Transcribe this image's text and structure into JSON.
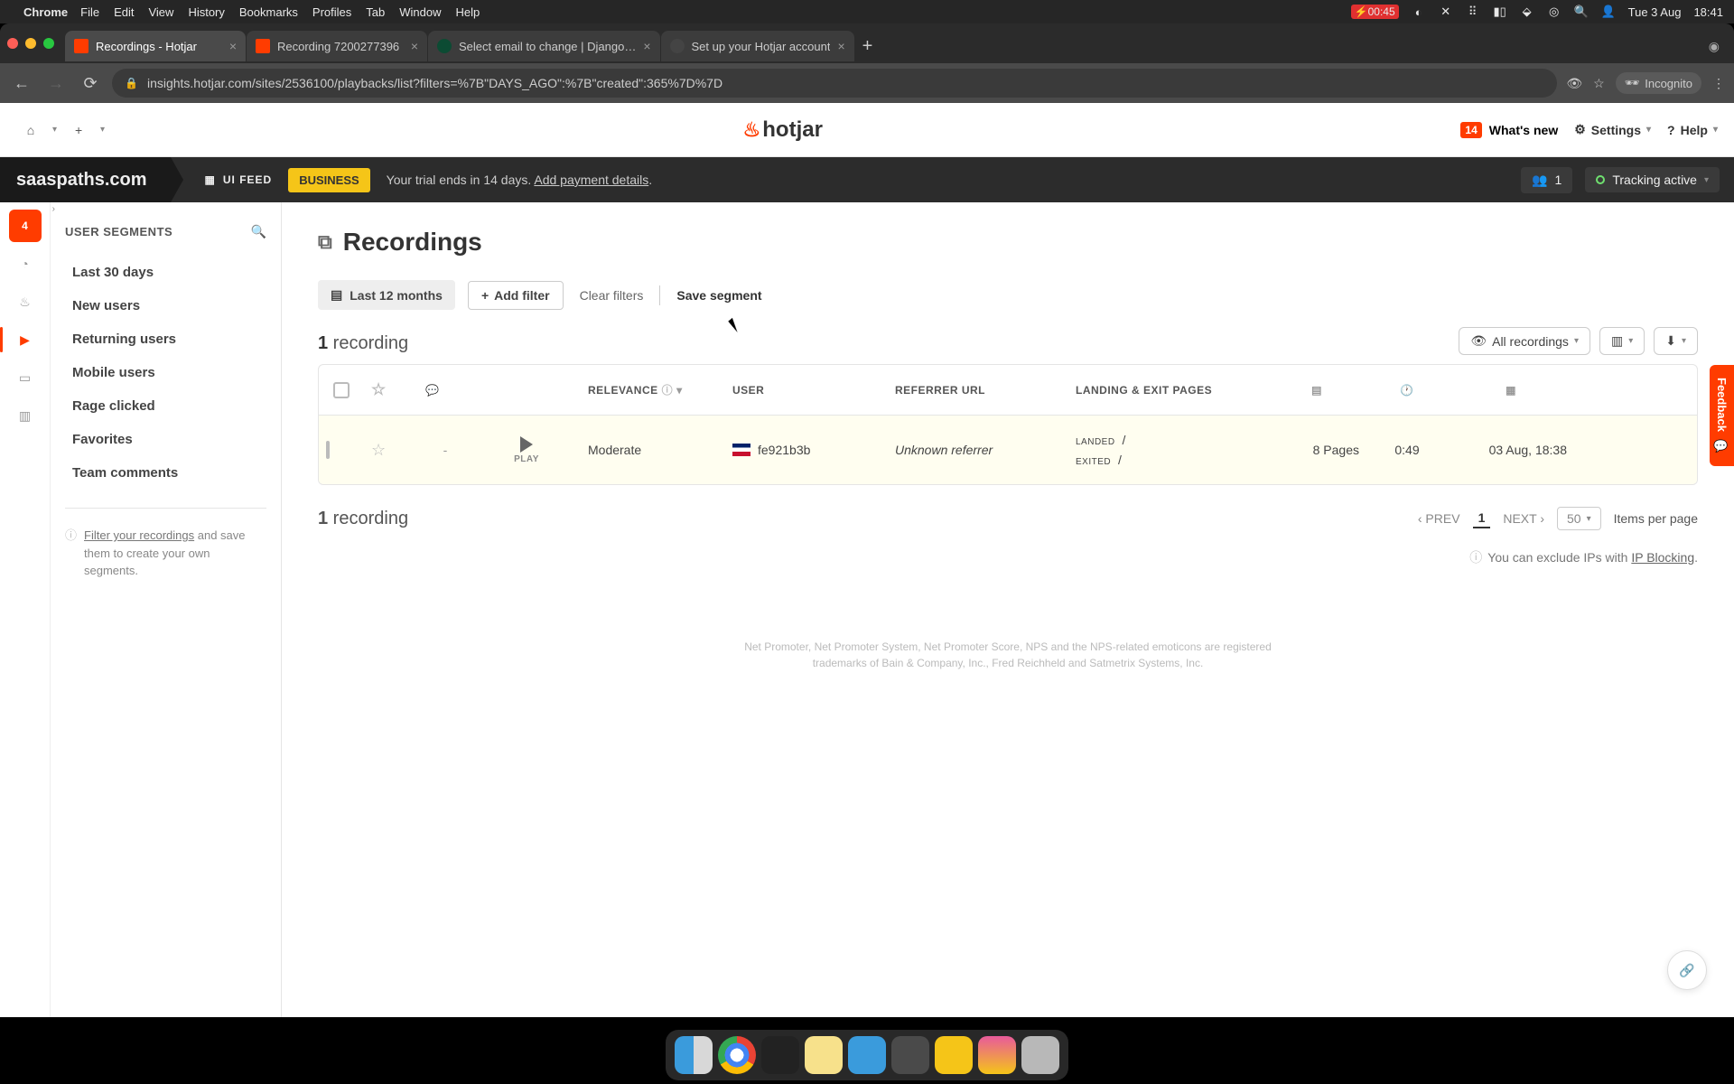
{
  "mac_menu": {
    "app": "Chrome",
    "items": [
      "File",
      "Edit",
      "View",
      "History",
      "Bookmarks",
      "Profiles",
      "Tab",
      "Window",
      "Help"
    ],
    "battery_warn": "00:45",
    "date": "Tue 3 Aug",
    "time": "18:41"
  },
  "chrome": {
    "tabs": [
      {
        "title": "Recordings - Hotjar",
        "active": true,
        "favicon": "hotjar"
      },
      {
        "title": "Recording 7200277396",
        "active": false,
        "favicon": "hotjar"
      },
      {
        "title": "Select email to change | Django…",
        "active": false,
        "favicon": "django"
      },
      {
        "title": "Set up your Hotjar account",
        "active": false,
        "favicon": "hj2"
      }
    ],
    "url": "insights.hotjar.com/sites/2536100/playbacks/list?filters=%7B\"DAYS_AGO\":%7B\"created\":365%7D%7D",
    "incognito": "Incognito"
  },
  "hotjar": {
    "logo": "hotjar",
    "whats_new_badge": "14",
    "whats_new": "What's new",
    "settings": "Settings",
    "help": "Help",
    "site": "saaspaths.com",
    "uifeed": "UI FEED",
    "plan_badge": "BUSINESS",
    "trial_text": "Your trial ends in 14 days. ",
    "trial_link": "Add payment details",
    "trial_period": ".",
    "user_count": "1",
    "tracking": "Tracking active",
    "rail_badge": "4",
    "segments_title": "USER SEGMENTS",
    "segments": [
      "Last 30 days",
      "New users",
      "Returning users",
      "Mobile users",
      "Rage clicked",
      "Favorites",
      "Team comments"
    ],
    "seg_hint_link": "Filter your recordings",
    "seg_hint_rest": " and save them to create your own segments.",
    "page_title": "Recordings",
    "filter_chip": "Last 12 months",
    "add_filter": "Add filter",
    "clear_filters": "Clear filters",
    "save_segment": "Save segment",
    "count_num": "1",
    "count_label": " recording",
    "all_recordings": "All recordings",
    "columns": {
      "relevance": "RELEVANCE",
      "user": "USER",
      "referrer": "REFERRER URL",
      "landing": "LANDING & EXIT PAGES"
    },
    "row": {
      "play": "PLAY",
      "comment": "-",
      "relevance": "Moderate",
      "user_id": "fe921b3b",
      "referrer": "Unknown referrer",
      "landed_label": "LANDED",
      "landed_path": "/",
      "exited_label": "EXITED",
      "exited_path": "/",
      "pages": "8 Pages",
      "duration": "0:49",
      "date": "03 Aug, 18:38"
    },
    "prev": "‹ PREV",
    "page": "1",
    "next": "NEXT ›",
    "per_page": "50",
    "per_page_label": "Items per page",
    "ip_hint_pre": "You can exclude IPs with ",
    "ip_hint_link": "IP Blocking",
    "legal": "Net Promoter, Net Promoter System, Net Promoter Score, NPS and the NPS-related emoticons are registered trademarks of Bain & Company, Inc., Fred Reichheld and Satmetrix Systems, Inc.",
    "feedback": "Feedback"
  }
}
